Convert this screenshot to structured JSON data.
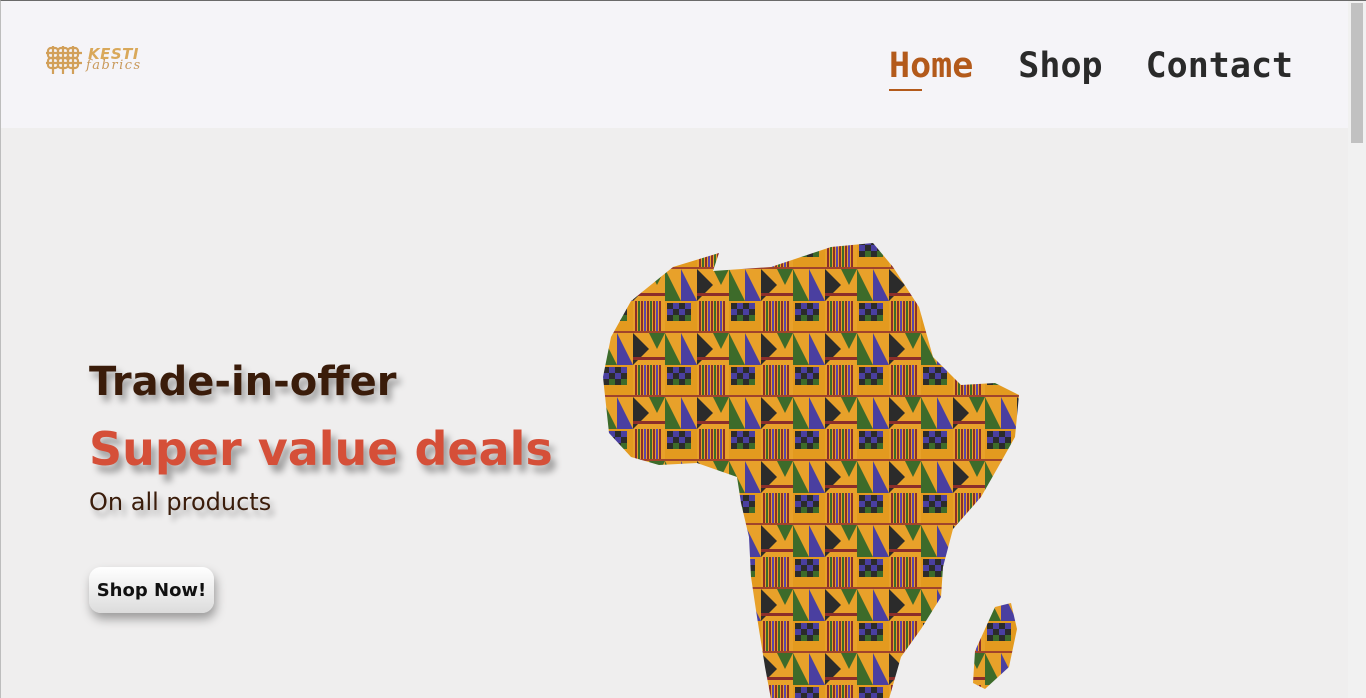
{
  "brand": {
    "name": "KESTI",
    "tagline": "fabrics"
  },
  "nav": {
    "items": [
      {
        "label": "Home",
        "active": true
      },
      {
        "label": "Shop",
        "active": false
      },
      {
        "label": "Contact",
        "active": false
      }
    ]
  },
  "hero": {
    "kicker": "Trade-in-offer",
    "title": "Super value deals",
    "subtitle": "On all products",
    "cta_label": "Shop Now!"
  },
  "colors": {
    "accent": "#b35a1b",
    "title": "#d54f38",
    "dark_text": "#3a1c0a",
    "header_bg": "#f5f4f8",
    "hero_bg": "#efeeee"
  },
  "icons": {
    "logo": "kente-knot-logo-icon",
    "hero_image": "africa-kente-map-image"
  }
}
